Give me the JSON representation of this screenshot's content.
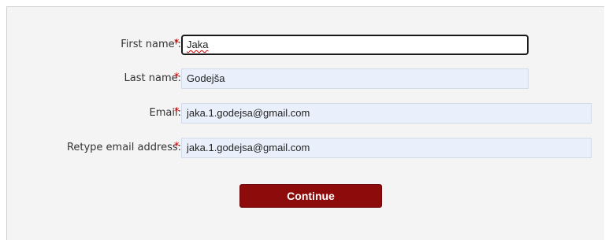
{
  "form": {
    "fields": [
      {
        "label": "First name",
        "label_suffix": ":",
        "footnote_mark": "†",
        "required_mark": "*",
        "value": "Jaka"
      },
      {
        "label": "Last name:",
        "required_mark": "*",
        "value": "Godejša"
      },
      {
        "label": "Email:",
        "required_mark": "*",
        "value": "jaka.1.godejsa@gmail.com"
      },
      {
        "label": "Retype email address:",
        "required_mark": "*",
        "value": "jaka.1.godejsa@gmail.com"
      }
    ],
    "continue_label": "Continue"
  },
  "colors": {
    "required": "#cc0000",
    "button": "#8e0b0b",
    "field_background": "#eaf0fb",
    "panel_background": "#f4f4f4"
  }
}
